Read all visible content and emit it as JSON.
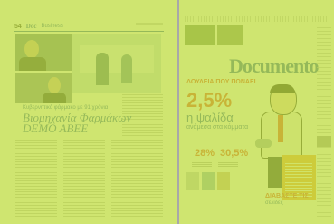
{
  "left_page": {
    "page_number": "54",
    "brand": "Doc",
    "section": "Business",
    "kicker": "Κυβερνητικό φάρμακο με 91 χρόνια",
    "headline": "Βιομηχανία Φαρμάκων DEMO ABEE"
  },
  "right_page": {
    "title": "Documento",
    "kicker": "ΔΟΥΛΕΙΑ ΠΟΥ ΠΟΝΑΕΙ",
    "percentage": "2,5%",
    "subtitle": "η ψαλίδα",
    "subtitle_detail": "ανάμεσα στα κόμματα",
    "stat_1": "28%",
    "stat_2": "30,5%",
    "bottom_title": "ΔΙΑΒΑΣΤΕ ΤΙΣ",
    "bottom_subtitle": "σελίδες"
  },
  "colors": {
    "accent": "#2c5fa6",
    "highlight": "#bedc3c",
    "red": "#e24b2b"
  }
}
